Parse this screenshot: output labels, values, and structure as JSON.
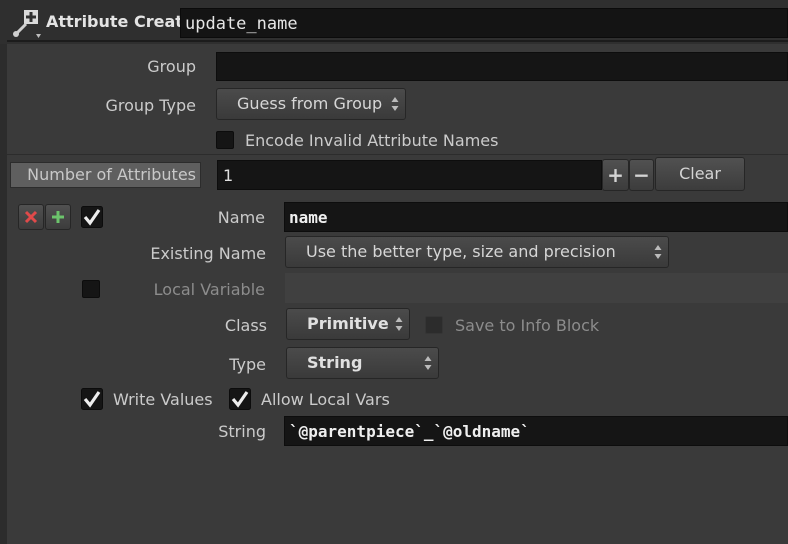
{
  "node": {
    "type_label": "Attribute Create",
    "name": "update_name",
    "icon": "attribute-create-node-icon"
  },
  "group": {
    "label": "Group",
    "value": ""
  },
  "group_type": {
    "label": "Group Type",
    "value": "Guess from Group"
  },
  "encode_invalid": {
    "label": "Encode Invalid Attribute Names",
    "checked": false
  },
  "num_attributes": {
    "label": "Number of Attributes",
    "value": "1",
    "add_label": "+",
    "remove_label": "−",
    "clear_label": "Clear"
  },
  "attribute": {
    "remove_icon": "x-icon",
    "insert_icon": "plus-icon",
    "enabled": true,
    "name_label": "Name",
    "name_value": "name",
    "existing_name_label": "Existing Name",
    "existing_name_value": "Use the better type, size and precision",
    "local_variable_label": "Local Variable",
    "local_variable_checked": false,
    "local_variable_value": "",
    "class_label": "Class",
    "class_value": "Primitive",
    "save_info_label": "Save to Info Block",
    "save_info_checked": false,
    "type_label": "Type",
    "type_value": "String",
    "write_values_label": "Write Values",
    "write_values_checked": true,
    "allow_local_vars_label": "Allow Local Vars",
    "allow_local_vars_checked": true,
    "string_label": "String",
    "string_value": "`@parentpiece`_`@oldname`"
  }
}
